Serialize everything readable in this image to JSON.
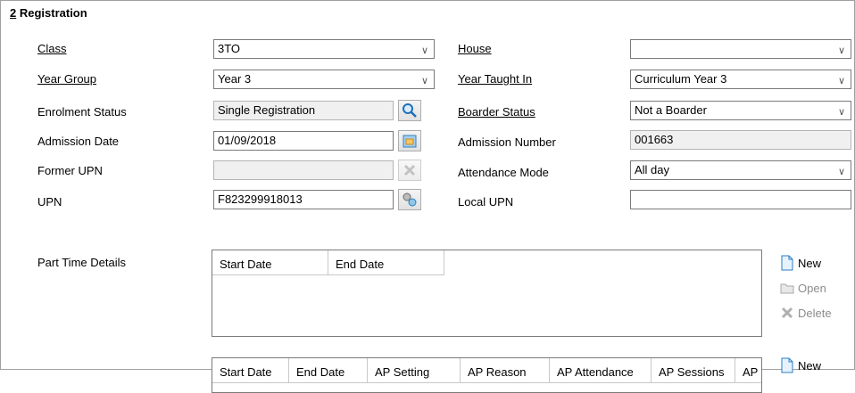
{
  "section": {
    "number": "2",
    "title": " Registration"
  },
  "left": {
    "class": {
      "label": "Class",
      "value": "3TO"
    },
    "year_group": {
      "label": "Year Group",
      "value": "Year  3"
    },
    "enrolment_status": {
      "label": "Enrolment Status",
      "value": "Single Registration"
    },
    "admission_date": {
      "label": "Admission Date",
      "value": "01/09/2018"
    },
    "former_upn": {
      "label": "Former UPN",
      "value": ""
    },
    "upn": {
      "label": "UPN",
      "value": "F823299918013"
    }
  },
  "right": {
    "house": {
      "label": "House",
      "value": ""
    },
    "year_taught_in": {
      "label": "Year Taught In",
      "value": "Curriculum Year  3"
    },
    "boarder_status": {
      "label": "Boarder Status",
      "value": "Not a Boarder"
    },
    "admission_number": {
      "label": "Admission Number",
      "value": "001663"
    },
    "attendance_mode": {
      "label": "Attendance Mode",
      "value": "All day"
    },
    "local_upn": {
      "label": "Local UPN",
      "value": ""
    }
  },
  "part_time": {
    "label": "Part Time Details",
    "columns": [
      "Start Date",
      "End Date"
    ],
    "actions": {
      "new": "New",
      "open": "Open",
      "delete": "Delete"
    }
  },
  "second_grid": {
    "columns": [
      "Start Date",
      "End Date",
      "AP Setting",
      "AP Reason",
      "AP Attendance",
      "AP Sessions",
      "AP"
    ],
    "actions": {
      "new": "New"
    }
  },
  "icons": {
    "chevron": "chevron-down-icon",
    "search": "magnifier-icon",
    "calendar": "calendar-icon",
    "clear": "clear-x-icon",
    "generate": "gears-icon"
  }
}
